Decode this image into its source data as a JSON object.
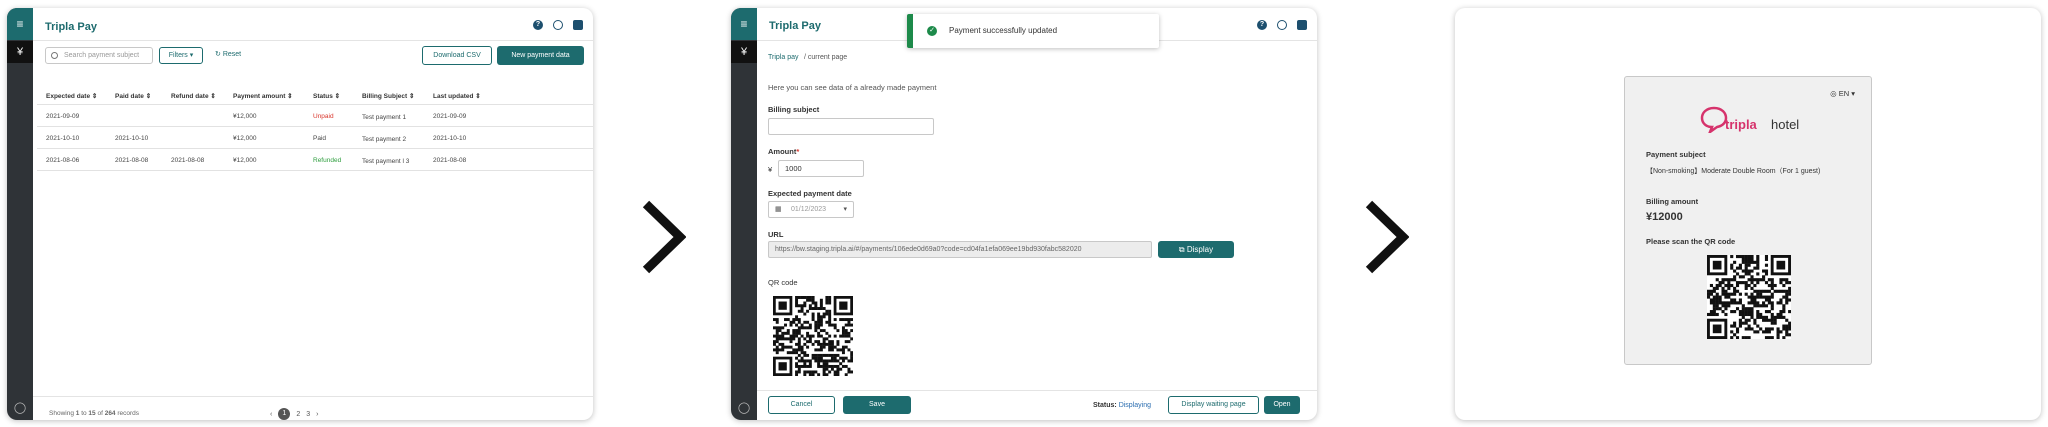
{
  "panel1": {
    "app_title": "Tripla Pay",
    "rail_yen": "¥",
    "search_placeholder": "Search payment subject",
    "filters_label": "Filters ▾",
    "reset_label": "Reset",
    "download_csv": "Download CSV",
    "new_payment": "New payment data",
    "columns": [
      "Expected date ⇕",
      "Paid date ⇕",
      "Refund date ⇕",
      "Payment amount ⇕",
      "Status ⇕",
      "Billing Subject ⇕",
      "Last updated ⇕"
    ],
    "rows": [
      {
        "expected": "2021-09-09",
        "paid": "",
        "refund": "",
        "amount": "¥12,000",
        "status": "Unpaid",
        "subject": "Test payment 1",
        "updated": "2021-09-09"
      },
      {
        "expected": "2021-10-10",
        "paid": "2021-10-10",
        "refund": "",
        "amount": "¥12,000",
        "status": "Paid",
        "subject": "Test payment 2",
        "updated": "2021-10-10"
      },
      {
        "expected": "2021-08-06",
        "paid": "2021-08-08",
        "refund": "2021-08-08",
        "amount": "¥12,000",
        "status": "Refunded",
        "subject": "Test payment l 3",
        "updated": "2021-08-08"
      }
    ],
    "showing": {
      "prefix": "Showing",
      "from": "1",
      "to_word": "to",
      "to": "15",
      "of_word": "of",
      "total": "264",
      "suffix": "records"
    },
    "pages": [
      "1",
      "2",
      "3"
    ]
  },
  "panel2": {
    "app_title": "Tripla Pay",
    "rail_yen": "¥",
    "toast": "Payment successfully updated",
    "breadcrumb_link": "Tripla pay",
    "breadcrumb_current": "/ current page",
    "intro": "Here you can see data of a already made payment",
    "billing_subject_label": "Billing subject",
    "billing_subject_value": "",
    "amount_label": "Amount",
    "required_mark": "*",
    "currency": "¥",
    "amount_value": "1000",
    "expected_date_label": "Expected payment date",
    "expected_date_value": "01/12/2023",
    "url_label": "URL",
    "url_value": "https://bw.staging.tripla.ai/#/payments/106ede0d69a0?code=cd04fa1efa069ee19bd930fabc582020",
    "display_button": "Display",
    "qr_label": "QR code",
    "cancel": "Cancel",
    "save": "Save",
    "status_label": "Status:",
    "status_value": "Displaying",
    "display_waiting": "Display waiting page",
    "open": "Open"
  },
  "panel3": {
    "lang": "EN ▾",
    "logo_word": "tripla",
    "logo_suffix": "hotel",
    "payment_subject_label": "Payment subject",
    "payment_subject_value": "【Non-smoking】Moderate Double Room（For 1 guest)",
    "billing_amount_label": "Billing amount",
    "billing_amount_value": "¥12000",
    "scan_label": "Please scan the QR code"
  },
  "colors": {
    "accent": "#1d6b6e",
    "unpaid": "#d9352b",
    "refunded": "#2e9e3e",
    "toast": "#1d8a4a"
  },
  "icons": [
    "menu-icon",
    "help-icon",
    "globe-icon",
    "user-icon",
    "chat-icon",
    "chevron-right-icon",
    "search-icon",
    "refresh-icon",
    "calendar-icon",
    "external-link-icon",
    "check-circle-icon"
  ]
}
